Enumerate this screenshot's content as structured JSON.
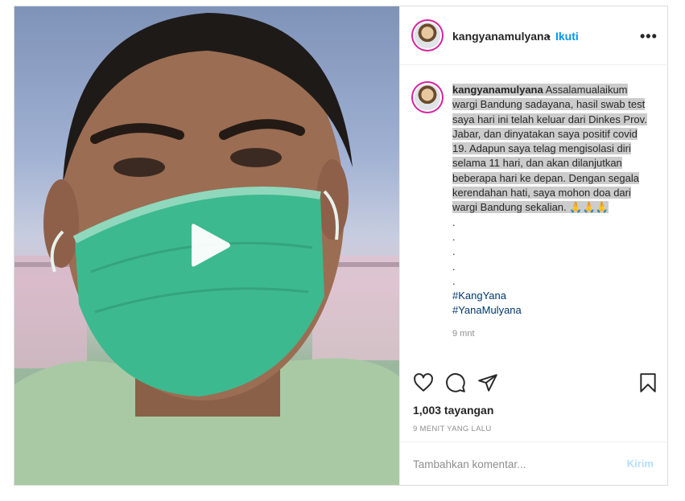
{
  "media": {
    "play_icon": "play-icon"
  },
  "header": {
    "username": "kangyanamulyana",
    "separator": "•",
    "follow_label": "Ikuti",
    "more_label": "•••"
  },
  "caption": {
    "username": "kangyanamulyana",
    "text": "Assalamualaikum wargi Bandung sadayana, hasil swab test saya hari ini telah keluar dari Dinkes Prov. Jabar, dan dinyatakan saya positif covid 19. Adapun saya telag mengisolasi diri selama 11 hari, dan akan dilanjutkan beberapa hari ke depan. Dengan segala kerendahan hati, saya mohon doa dari wargi Bandung sekalian. 🙏🙏🙏",
    "dots": [
      ".",
      ".",
      ".",
      ".",
      "."
    ],
    "hashtags": [
      "#KangYana",
      "#YanaMulyana"
    ],
    "time": "9 mnt"
  },
  "actions": {
    "like_icon": "heart-icon",
    "comment_icon": "comment-icon",
    "share_icon": "share-icon",
    "save_icon": "bookmark-icon"
  },
  "stats": {
    "views": "1,003 tayangan",
    "date": "9 MENIT YANG LALU"
  },
  "comment_box": {
    "placeholder": "Tambahkan komentar...",
    "post_label": "Kirim"
  },
  "colors": {
    "link": "#0095f6",
    "hashtag": "#00376b",
    "muted": "#8e8e8e",
    "post_disabled": "#b2dffc"
  }
}
